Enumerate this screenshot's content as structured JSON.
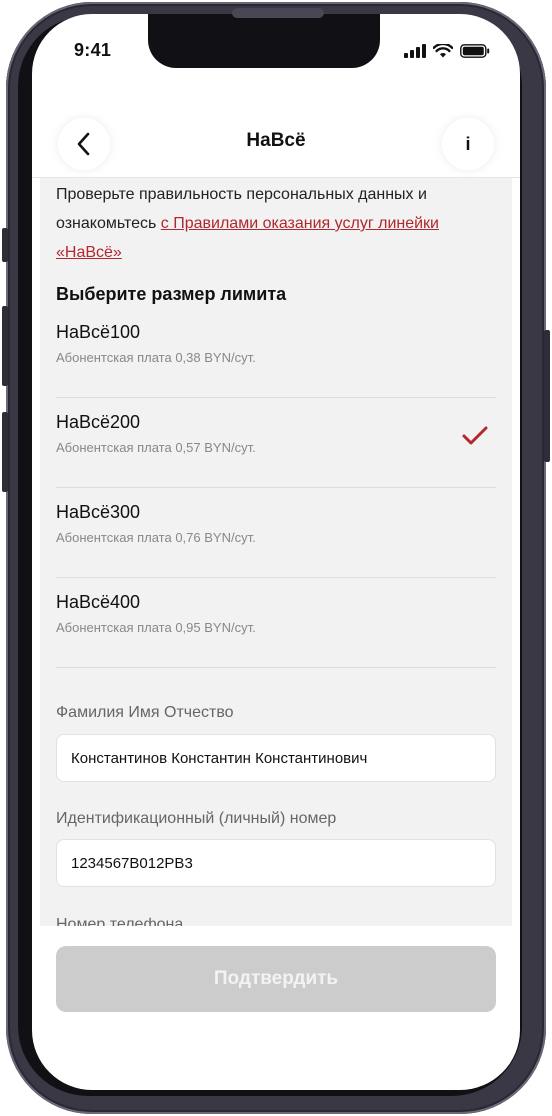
{
  "status_bar": {
    "time": "9:41"
  },
  "header": {
    "title": "НаВсё",
    "info_label": "i"
  },
  "intro": {
    "text": "Проверьте правильность персональных данных и ознакомьтесь ",
    "link_text": "с Правилами оказания услуг линейки «НаВсё»"
  },
  "section_title": "Выберите размер лимита",
  "tariffs": [
    {
      "name": "НаВсё100",
      "fee": "Абонентская плата 0,38 BYN/сут.",
      "selected": false
    },
    {
      "name": "НаВсё200",
      "fee": "Абонентская плата 0,57 BYN/сут.",
      "selected": true
    },
    {
      "name": "НаВсё300",
      "fee": "Абонентская плата 0,76 BYN/сут.",
      "selected": false
    },
    {
      "name": "НаВсё400",
      "fee": "Абонентская плата 0,95 BYN/сут.",
      "selected": false
    }
  ],
  "form": {
    "full_name": {
      "label": "Фамилия Имя Отчество",
      "value": "Константинов Константин Константинович"
    },
    "id_number": {
      "label": "Идентификационный (личный) номер",
      "value": "1234567B012PB3"
    },
    "phone": {
      "label": "Номер телефона"
    }
  },
  "confirm_label": "Подтвердить",
  "colors": {
    "accent": "#b2282e",
    "disabled_button": "#cccccc",
    "content_bg": "#f2f2f2"
  }
}
